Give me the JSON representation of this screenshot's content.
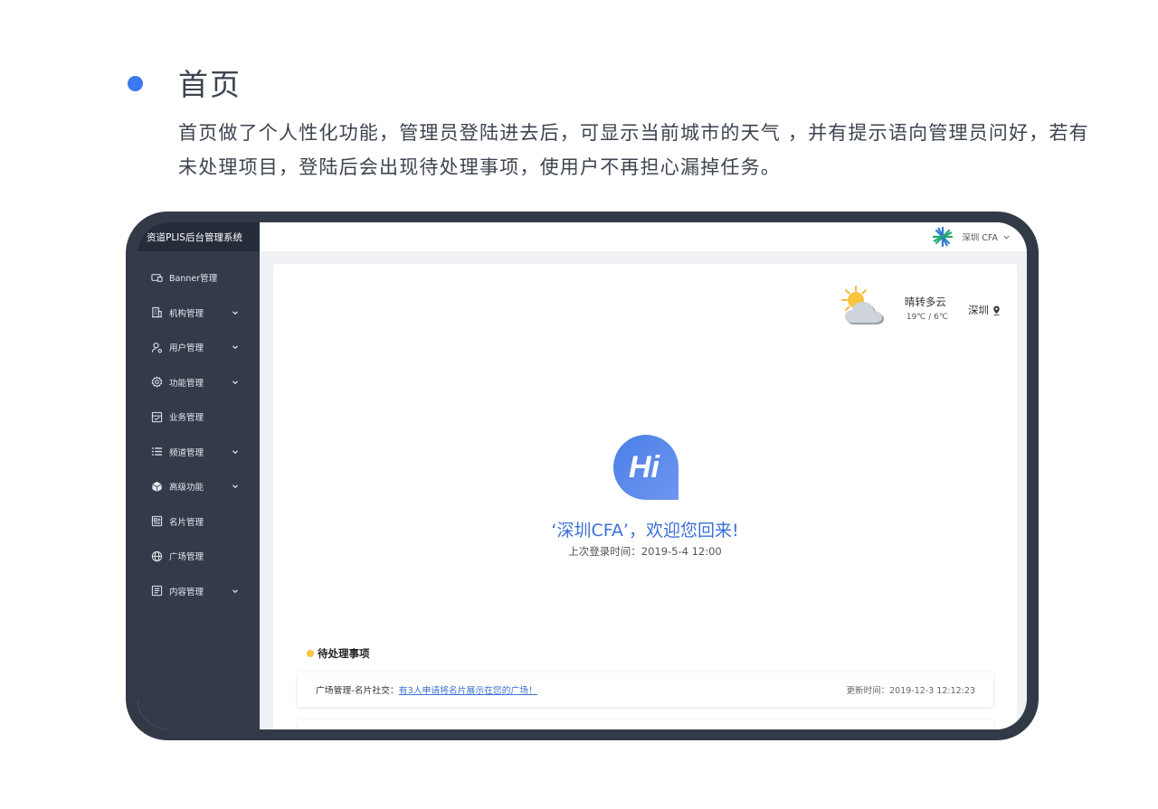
{
  "intro": {
    "title": "首页",
    "description": "首页做了个人性化功能，管理员登陆进去后，可显示当前城市的天气 ，并有提示语向管理员问好，若有未处理项目，登陆后会出现待处理事项，使用户不再担心漏掉任务。"
  },
  "app": {
    "brand": "资道PLIS后台管理系统",
    "user_label": "深圳 CFA"
  },
  "sidebar": {
    "items": [
      {
        "label": "Banner管理",
        "icon": "banner-icon",
        "has_children": false
      },
      {
        "label": "机构管理",
        "icon": "building-icon",
        "has_children": true
      },
      {
        "label": "用户管理",
        "icon": "user-icon",
        "has_children": true
      },
      {
        "label": "功能管理",
        "icon": "gear-icon",
        "has_children": true
      },
      {
        "label": "业务管理",
        "icon": "business-icon",
        "has_children": false
      },
      {
        "label": "频道管理",
        "icon": "list-icon",
        "has_children": true
      },
      {
        "label": "高级功能",
        "icon": "cube-icon",
        "has_children": true
      },
      {
        "label": "名片管理",
        "icon": "card-icon",
        "has_children": false
      },
      {
        "label": "广场管理",
        "icon": "globe-icon",
        "has_children": false
      },
      {
        "label": "内容管理",
        "icon": "document-icon",
        "has_children": true
      }
    ]
  },
  "weather": {
    "description": "晴转多云",
    "temperature": "19℃ / 6℃",
    "city": "深圳",
    "icon": "partly-cloudy-icon"
  },
  "greeting": {
    "badge": "Hi",
    "welcome": "‘深圳CFA’，欢迎您回来!",
    "last_login": "上次登录时间：2019-5-4  12:00"
  },
  "todo": {
    "title": "待处理事项",
    "items": [
      {
        "prefix": "广场管理-名片社交：",
        "link": "有3人申请将名片展示在您的广场！",
        "time": "更新时间：2019-12-3 12:12:23"
      }
    ]
  },
  "colors": {
    "accent": "#3a79f0",
    "sidebar_bg": "#333b4a",
    "device_frame": "#333a47",
    "todo_dot": "#f6c343",
    "link": "#3b6fd6"
  }
}
